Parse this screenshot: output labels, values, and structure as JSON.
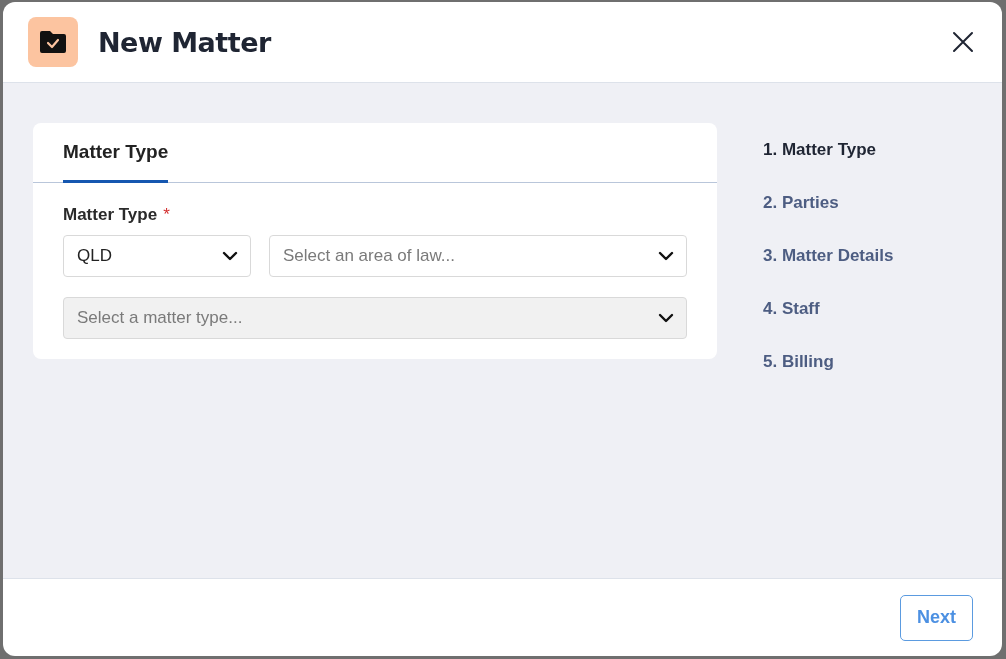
{
  "dialog": {
    "title": "New Matter"
  },
  "tabs": [
    {
      "label": "Matter Type",
      "selected": true
    }
  ],
  "field": {
    "label": "Matter Type",
    "required": true,
    "required_mark": "*",
    "selects": [
      {
        "value": "QLD",
        "disabled": false
      },
      {
        "placeholder": "Select an area of law...",
        "disabled": false
      },
      {
        "placeholder": "Select a matter type...",
        "disabled": true
      }
    ]
  },
  "steps": [
    {
      "label": "1. Matter Type",
      "selected": true
    },
    {
      "label": "2. Parties",
      "selected": false
    },
    {
      "label": "3. Matter Details",
      "selected": false
    },
    {
      "label": "4. Staff",
      "selected": false
    },
    {
      "label": "5. Billing",
      "selected": false
    }
  ],
  "footer": {
    "buttons": [
      "Next"
    ]
  }
}
